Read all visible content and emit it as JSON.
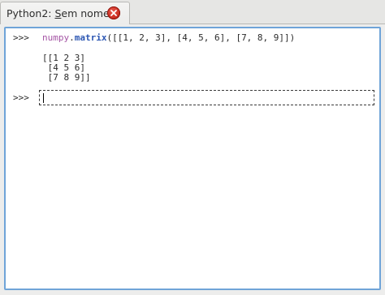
{
  "tab": {
    "label_prefix": "Python2: ",
    "label_mnemonic": "S",
    "label_rest": "em nome",
    "close_icon": "close-icon"
  },
  "console": {
    "history": {
      "prompt": ">>>",
      "command": {
        "module": "numpy",
        "dot": ".",
        "function": "matrix",
        "args": "([[1, 2, 3], [4, 5, 6], [7, 8, 9]])"
      },
      "output_lines": [
        "[[1 2 3]",
        " [4 5 6]",
        " [7 8 9]]"
      ]
    },
    "input": {
      "prompt": ">>>",
      "value": ""
    }
  },
  "colors": {
    "accent_border": "#6fa4d8",
    "module_color": "#a454a4",
    "function_color": "#2d57b3",
    "close_button": "#c8261a"
  }
}
